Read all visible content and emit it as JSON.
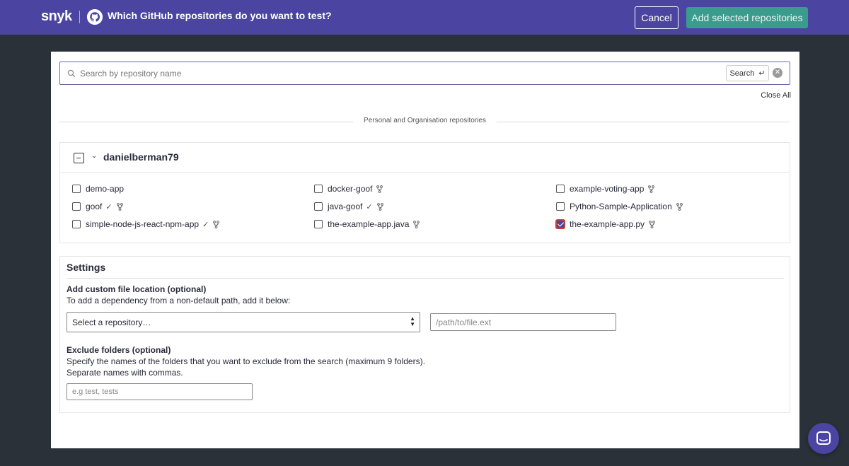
{
  "topbar": {
    "logo": "snyk",
    "title": "Which GitHub repositories do you want to test?",
    "cancel_label": "Cancel",
    "add_label": "Add selected repositories",
    "bg_color": "#4b45a1"
  },
  "search": {
    "placeholder": "Search by repository name",
    "value": "",
    "button_label": "Search",
    "button_icon": "↵"
  },
  "close_all": "Close All",
  "section_title": "Personal and Organisation repositories",
  "owner": {
    "name": "danielberman79",
    "state": "partial"
  },
  "repos": [
    {
      "name": "demo-app",
      "checked": false,
      "imported": false,
      "fork": false
    },
    {
      "name": "docker-goof",
      "checked": false,
      "imported": false,
      "fork": true
    },
    {
      "name": "example-voting-app",
      "checked": false,
      "imported": false,
      "fork": true
    },
    {
      "name": "goof",
      "checked": false,
      "imported": true,
      "fork": true
    },
    {
      "name": "java-goof",
      "checked": false,
      "imported": true,
      "fork": true
    },
    {
      "name": "Python-Sample-Application",
      "checked": false,
      "imported": false,
      "fork": true
    },
    {
      "name": "simple-node-js-react-npm-app",
      "checked": false,
      "imported": true,
      "fork": true
    },
    {
      "name": "the-example-app.java",
      "checked": false,
      "imported": false,
      "fork": true
    },
    {
      "name": "the-example-app.py",
      "checked": true,
      "imported": false,
      "fork": true
    }
  ],
  "settings": {
    "title": "Settings",
    "custom_location_label": "Add custom file location (optional)",
    "custom_location_help": "To add a dependency from a non-default path, add it below:",
    "select_repo_value": "Select a repository…",
    "path_placeholder": "/path/to/file.ext",
    "exclude_label": "Exclude folders (optional)",
    "exclude_help_1": "Specify the names of the folders that you want to exclude from the search (maximum 9 folders).",
    "exclude_help_2": "Separate names with commas.",
    "exclude_placeholder": "e.g test, tests"
  },
  "icons": {
    "imported": "check-icon",
    "fork": "fork-icon",
    "chat": "chat-icon"
  }
}
